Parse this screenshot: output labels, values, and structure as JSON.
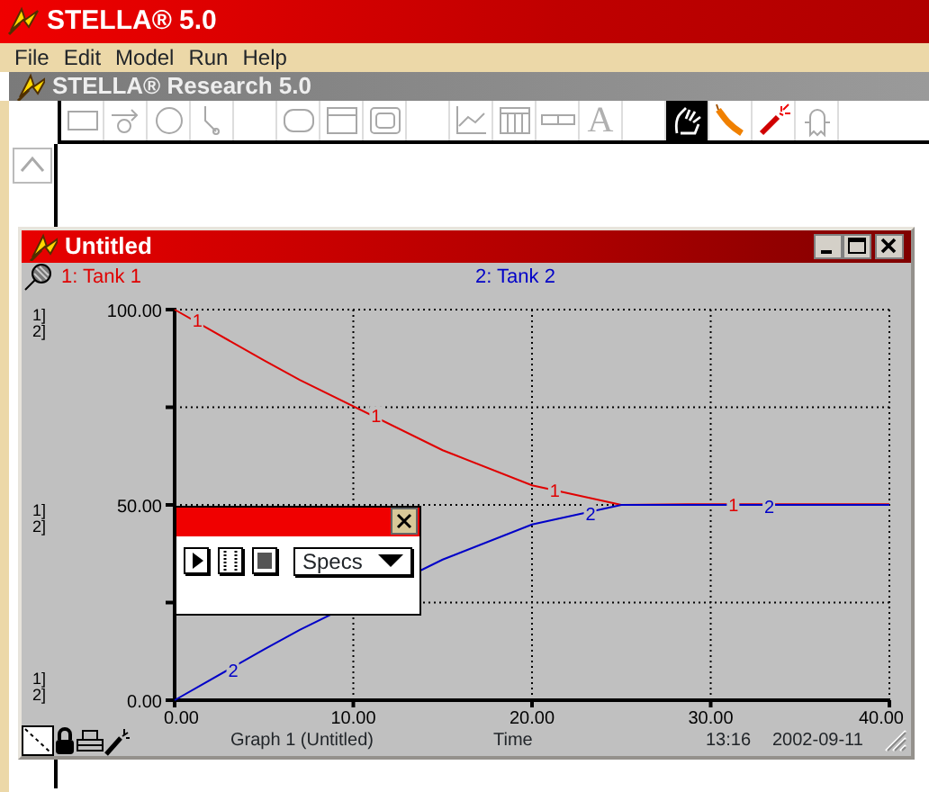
{
  "app": {
    "title": "STELLA® 5.0"
  },
  "menu": [
    {
      "label": "File"
    },
    {
      "label": "Edit"
    },
    {
      "label": "Model"
    },
    {
      "label": "Run"
    },
    {
      "label": "Help"
    }
  ],
  "document_window": {
    "title": "STELLA® Research 5.0"
  },
  "toolbar": {
    "groups": [
      [
        {
          "kind": "stock",
          "disabled": true,
          "selected": false
        },
        {
          "kind": "flow",
          "disabled": true,
          "selected": false
        },
        {
          "kind": "converter",
          "disabled": true,
          "selected": false
        },
        {
          "kind": "connector",
          "disabled": true,
          "selected": false
        }
      ],
      [
        {
          "kind": "decision",
          "disabled": true,
          "selected": false
        },
        {
          "kind": "window",
          "disabled": true,
          "selected": false
        },
        {
          "kind": "frame",
          "disabled": true,
          "selected": false
        }
      ],
      [
        {
          "kind": "graph",
          "disabled": true,
          "selected": false
        },
        {
          "kind": "table",
          "disabled": true,
          "selected": false
        },
        {
          "kind": "slider",
          "disabled": true,
          "selected": false
        },
        {
          "kind": "text",
          "label": "A",
          "disabled": true,
          "selected": false
        }
      ],
      [
        {
          "kind": "hand",
          "disabled": false,
          "selected": true
        },
        {
          "kind": "dynamite",
          "disabled": false,
          "selected": false
        },
        {
          "kind": "wand",
          "disabled": false,
          "selected": false
        },
        {
          "kind": "ghost",
          "disabled": true,
          "selected": false
        }
      ]
    ]
  },
  "graph_window": {
    "title": "Untitled",
    "scale_labels": [
      [
        "1]",
        "2]"
      ],
      [
        "1]",
        "2]"
      ],
      [
        "1]",
        "2]"
      ]
    ],
    "chart_data": {
      "type": "line",
      "xlabel": "Time",
      "grid": true,
      "x": [
        0,
        5,
        7,
        15,
        20,
        25,
        30,
        35,
        40
      ],
      "annotations": [
        {
          "text": "1",
          "x": 1,
          "y": 97.4
        },
        {
          "text": "1",
          "x": 11,
          "y": 73
        },
        {
          "text": "1",
          "x": 21,
          "y": 54
        },
        {
          "text": "1",
          "x": 31,
          "y": 50.2
        },
        {
          "text": "2",
          "x": 3,
          "y": 7.8
        },
        {
          "text": "2",
          "x": 23,
          "y": 48
        },
        {
          "text": "2",
          "x": 33,
          "y": 49.8
        }
      ],
      "series": [
        {
          "name": "1: Tank 1",
          "color": "#e00000",
          "values": [
            100,
            87,
            82,
            64,
            55,
            50,
            50.2,
            50.2,
            50.2
          ]
        },
        {
          "name": "2: Tank 2",
          "color": "#0000c8",
          "values": [
            0,
            13,
            18,
            36,
            45,
            50,
            50,
            50,
            50
          ]
        }
      ],
      "xlim": [
        0,
        40
      ],
      "ylim": [
        0,
        100
      ],
      "xticks": [
        {
          "value": 0,
          "label": "0.00"
        },
        {
          "value": 10,
          "label": "10.00"
        },
        {
          "value": 20,
          "label": "20.00"
        },
        {
          "value": 30,
          "label": "30.00"
        },
        {
          "value": 40,
          "label": "40.00"
        }
      ],
      "yticks": [
        {
          "value": 0,
          "label": "0.00"
        },
        {
          "value": 50,
          "label": "50.00"
        },
        {
          "value": 100,
          "label": "100.00"
        }
      ]
    },
    "palette": {
      "buttons": [
        {
          "kind": "run"
        },
        {
          "kind": "pause"
        },
        {
          "kind": "stop"
        }
      ],
      "dropdown": "Specs"
    },
    "footer": {
      "page_title": "Graph 1 (Untitled)",
      "time": "13:16",
      "date": "2002-09-11"
    }
  }
}
